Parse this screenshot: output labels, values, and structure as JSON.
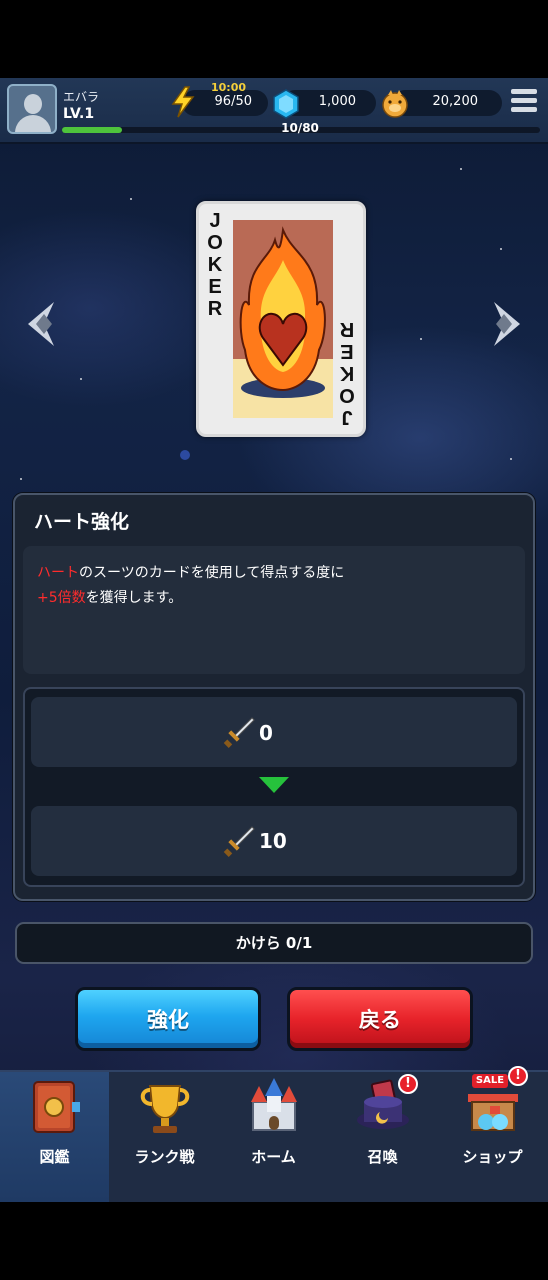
{
  "player": {
    "name": "エバラ",
    "level": "LV.1",
    "xp_text": "10/80",
    "xp_progress": 0.125
  },
  "resources": {
    "energy_timer": "10:00",
    "energy": "96/50",
    "gems": "1,000",
    "coins": "20,200"
  },
  "card": {
    "label": "JOKER",
    "colors": {
      "flame": "#ff7a1a",
      "heart": "#b8321f",
      "background": "#f7e3a5"
    }
  },
  "panel": {
    "title": "ハート強化",
    "description_line1_highlight": "ハート",
    "description_line1_rest": "のスーツのカードを使用して得点する度に",
    "description_line2_highlight": "+5倍数",
    "description_line2_rest": "を獲得します。",
    "current_value": "0",
    "next_value": "10"
  },
  "fragments": "かけら 0/1",
  "buttons": {
    "upgrade": "強化",
    "back": "戻る"
  },
  "nav": [
    {
      "label": "図鑑",
      "icon": "book-icon",
      "active": true,
      "badge": ""
    },
    {
      "label": "ランク戦",
      "icon": "trophy-icon",
      "active": false,
      "badge": ""
    },
    {
      "label": "ホーム",
      "icon": "castle-icon",
      "active": false,
      "badge": ""
    },
    {
      "label": "召喚",
      "icon": "summon-hat-icon",
      "active": false,
      "badge": "!"
    },
    {
      "label": "ショップ",
      "icon": "shop-icon",
      "active": false,
      "badge": "!",
      "tag": "SALE"
    }
  ],
  "colors": {
    "accent_blue": "#1ea6ef",
    "accent_red": "#e7232a",
    "highlight_red": "#ff2c2c",
    "xp_green": "#4ec43c"
  }
}
